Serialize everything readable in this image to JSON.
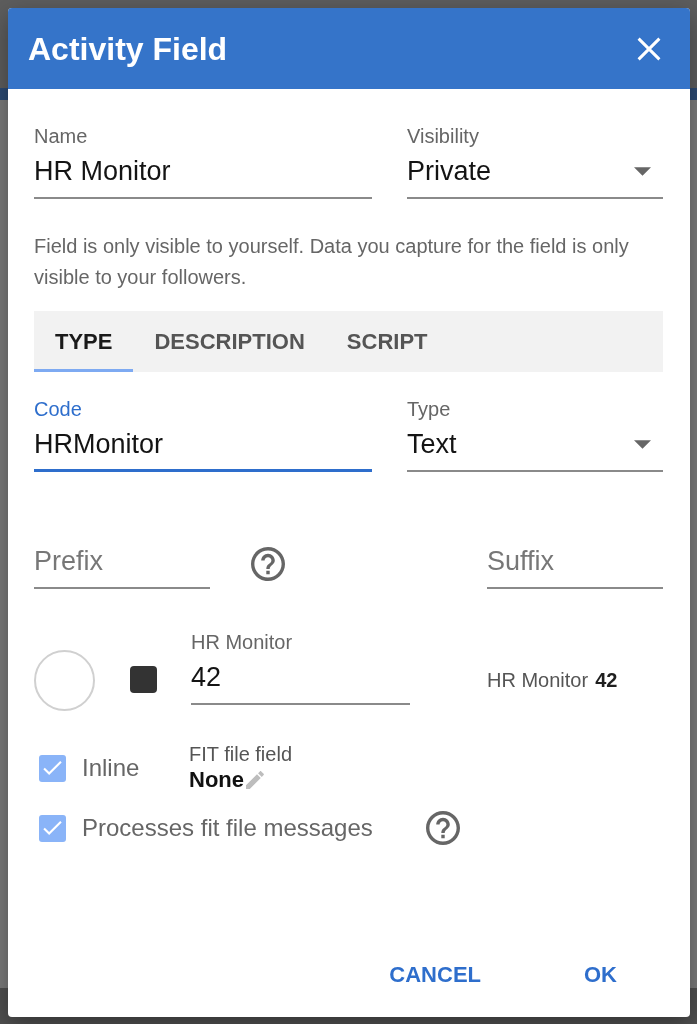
{
  "dialog": {
    "title": "Activity Field"
  },
  "top_fields": [
    {
      "kind": "text",
      "label": "Name",
      "value": "HR Monitor",
      "focused": false
    },
    {
      "kind": "select",
      "label": "Visibility",
      "value": "Private",
      "focused": false
    }
  ],
  "helper_text": "Field is only visible to yourself. Data you capture for the field is only visible to your followers.",
  "tabs": [
    {
      "label": "TYPE",
      "selected": true
    },
    {
      "label": "DESCRIPTION",
      "selected": false
    },
    {
      "label": "SCRIPT",
      "selected": false
    }
  ],
  "type_fields": [
    {
      "kind": "text",
      "label": "Code",
      "value": "HRMonitor",
      "focused": true
    },
    {
      "kind": "select",
      "label": "Type",
      "value": "Text",
      "focused": false
    }
  ],
  "prefix": {
    "placeholder": "Prefix"
  },
  "suffix": {
    "placeholder": "Suffix"
  },
  "value_preview": {
    "field_label": "HR Monitor",
    "field_value": "42",
    "display_label": "HR Monitor",
    "display_value": "42"
  },
  "inline_checkbox": {
    "label": "Inline",
    "checked": true
  },
  "fit_file_field": {
    "label": "FIT file field",
    "value": "None"
  },
  "processes_checkbox": {
    "label": "Processes fit file messages",
    "checked": true
  },
  "buttons": [
    {
      "label": "CANCEL"
    },
    {
      "label": "OK"
    }
  ]
}
